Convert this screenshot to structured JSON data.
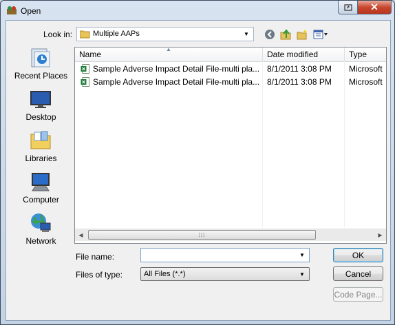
{
  "window": {
    "title": "Open"
  },
  "toolbar": {
    "lookin_label": "Look in:",
    "lookin_value": "Multiple AAPs"
  },
  "places": [
    {
      "label": "Recent Places",
      "icon": "recent-places-icon"
    },
    {
      "label": "Desktop",
      "icon": "desktop-icon"
    },
    {
      "label": "Libraries",
      "icon": "libraries-icon"
    },
    {
      "label": "Computer",
      "icon": "computer-icon"
    },
    {
      "label": "Network",
      "icon": "network-icon"
    }
  ],
  "filelist": {
    "columns": [
      "Name",
      "Date modified",
      "Type"
    ],
    "rows": [
      {
        "name": "Sample Adverse Impact Detail File-multi pla...",
        "date": "8/1/2011 3:08 PM",
        "type": "Microsoft"
      },
      {
        "name": "Sample Adverse Impact Detail File-multi pla...",
        "date": "8/1/2011 3:08 PM",
        "type": "Microsoft"
      }
    ]
  },
  "form": {
    "filename_label": "File name:",
    "filename_value": "",
    "filetype_label": "Files of type:",
    "filetype_value": "All Files (*.*)"
  },
  "buttons": {
    "ok": "OK",
    "cancel": "Cancel",
    "codepage": "Code Page..."
  },
  "colors": {
    "titlebar": "#c4d3e4",
    "close": "#c7472f",
    "ok_border": "#3c7fb1"
  }
}
